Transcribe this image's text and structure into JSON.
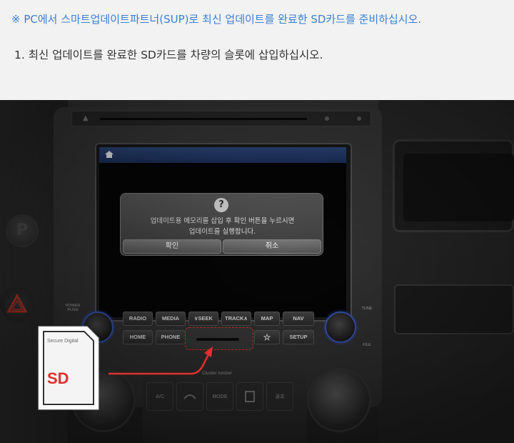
{
  "instructions": {
    "notice": "※ PC에서 스마트업데이트파트너(SUP)로 최신 업데이트를 완료한 SD카드를 준비하십시오.",
    "step1": "1. 최신 업데이트를 완료한 SD카드를 차량의 슬롯에 삽입하십시오."
  },
  "screen_dialog": {
    "message_line1": "업데이트용 메모리를 삽입 후 확인 버튼을 누르시면",
    "message_line2": "업데이트를 실행합니다.",
    "confirm_label": "확인",
    "cancel_label": "취소"
  },
  "head_unit": {
    "power_label": "POWER\nPUSH",
    "tune_label": "TUNE",
    "file_label": "FILE",
    "buttons_row1": [
      "RADIO",
      "MEDIA",
      "∨SEEK",
      "TRACK∧",
      "MAP",
      "NAV"
    ],
    "buttons_row2": [
      "HOME",
      "PHONE",
      "☆",
      "SETUP"
    ],
    "cluster_label": "Cluster Ionizer",
    "climate_buttons": [
      "A/C",
      "",
      "MODE",
      "",
      "공조"
    ]
  },
  "sd_card": {
    "brand_label": "Secure Digital",
    "logo_text": "SD"
  },
  "colors": {
    "accent_blue": "#3a7fd6",
    "highlight_red": "#e03030"
  }
}
